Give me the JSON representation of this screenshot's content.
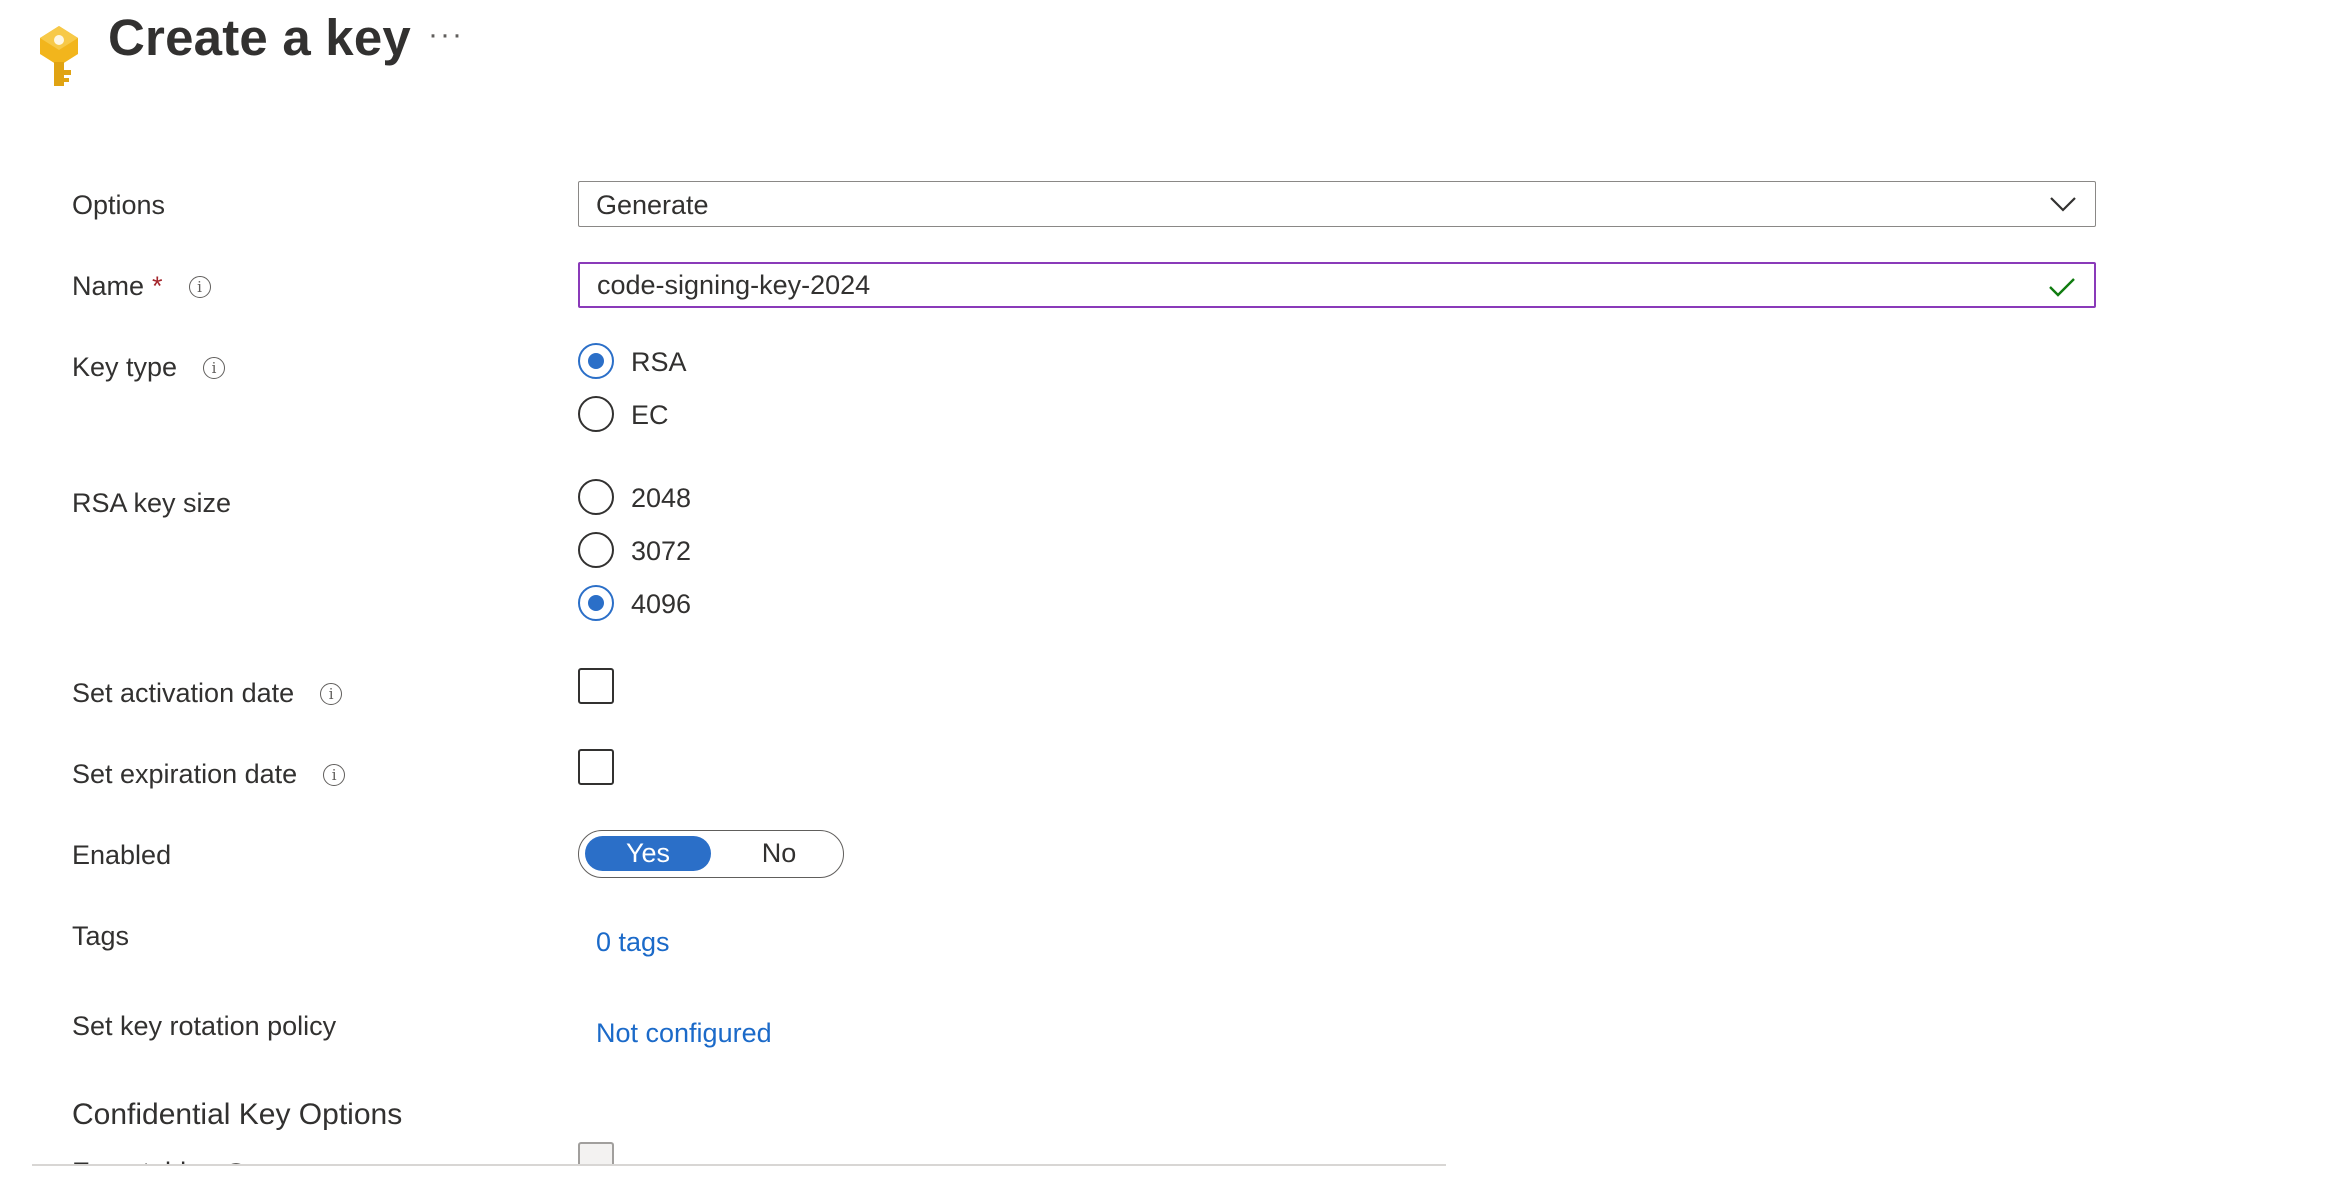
{
  "header": {
    "title": "Create a key",
    "more_label": "···",
    "key_icon_color": "#f2b51c"
  },
  "form": {
    "options": {
      "label": "Options",
      "value": "Generate"
    },
    "name": {
      "label": "Name",
      "required_mark": "*",
      "value": "code-signing-key-2024",
      "valid": true
    },
    "key_type": {
      "label": "Key type",
      "options": [
        "RSA",
        "EC"
      ],
      "selected": "RSA"
    },
    "rsa_key_size": {
      "label": "RSA key size",
      "options": [
        "2048",
        "3072",
        "4096"
      ],
      "selected": "4096"
    },
    "activation_date": {
      "label": "Set activation date",
      "checked": false
    },
    "expiration_date": {
      "label": "Set expiration date",
      "checked": false
    },
    "enabled": {
      "label": "Enabled",
      "yes": "Yes",
      "no": "No",
      "selected": "Yes"
    },
    "tags": {
      "label": "Tags",
      "value": "0 tags"
    },
    "rotation_policy": {
      "label": "Set key rotation policy",
      "value": "Not configured"
    },
    "confidential": {
      "section_title": "Confidential Key Options",
      "exportable_label": "Exportable"
    }
  },
  "colors": {
    "accent": "#2b6fc8",
    "link": "#1b6ac9",
    "focus_border": "#8a3ab9",
    "valid_check": "#107c10"
  }
}
